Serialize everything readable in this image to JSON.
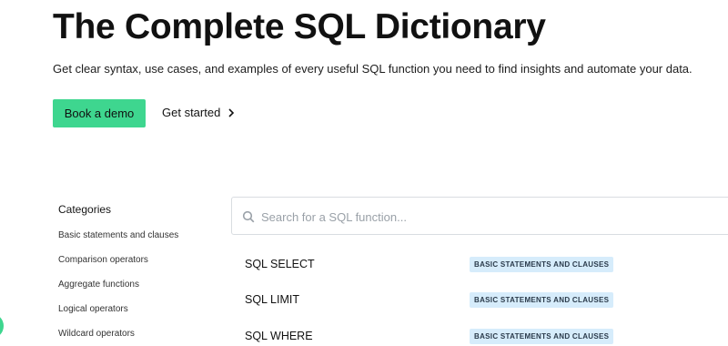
{
  "header": {
    "title": "The Complete SQL Dictionary",
    "subtitle": "Get clear syntax, use cases, and examples of every useful SQL function you need to find insights and automate your data.",
    "demo_button": "Book a demo",
    "get_started_link": "Get started"
  },
  "sidebar": {
    "heading": "Categories",
    "items": [
      {
        "label": "Basic statements and clauses"
      },
      {
        "label": "Comparison operators"
      },
      {
        "label": "Aggregate functions"
      },
      {
        "label": "Logical operators"
      },
      {
        "label": "Wildcard operators"
      }
    ]
  },
  "search": {
    "placeholder": "Search for a SQL function...",
    "value": ""
  },
  "functions": [
    {
      "name": "SQL SELECT",
      "category": "BASIC STATEMENTS AND CLAUSES"
    },
    {
      "name": "SQL LIMIT",
      "category": "BASIC STATEMENTS AND CLAUSES"
    },
    {
      "name": "SQL WHERE",
      "category": "BASIC STATEMENTS AND CLAUSES"
    }
  ],
  "colors": {
    "accent": "#3ed68f",
    "badge_bg": "#d6ecfb",
    "text": "#111111"
  },
  "icons": {
    "search": "search-icon",
    "chevron": "chevron-right-icon",
    "chat": "chat-bubble-icon"
  }
}
